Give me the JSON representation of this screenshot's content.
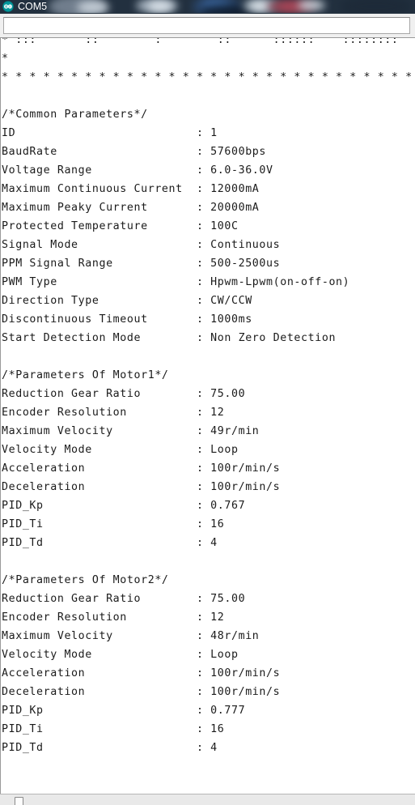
{
  "window": {
    "title": "COM5",
    "app_icon": "arduino-logo-icon",
    "titlebar_bg": "#22303f",
    "title_color": "#ffffff",
    "accent": "#00979c"
  },
  "toolbar": {
    "send_input_value": "",
    "send_input_placeholder": ""
  },
  "console": {
    "text_color": "#1b1b1b",
    "background": "#ffffff",
    "content": "* :::       ::        :        ::      ::::::    ::::::::       ::\n*\n* * * * * * * * * * * * * * * * * * * * * * * * * * * * * * * * *\n\n/*Common Parameters*/\nID                          : 1\nBaudRate                    : 57600bps\nVoltage Range               : 6.0-36.0V\nMaximum Continuous Current  : 12000mA\nMaximum Peaky Current       : 20000mA\nProtected Temperature       : 100C\nSignal Mode                 : Continuous\nPPM Signal Range            : 500-2500us\nPWM Type                    : Hpwm-Lpwm(on-off-on)\nDirection Type              : CW/CCW\nDiscontinuous Timeout       : 1000ms\nStart Detection Mode        : Non Zero Detection\n\n/*Parameters Of Motor1*/\nReduction Gear Ratio        : 75.00\nEncoder Resolution          : 12\nMaximum Velocity            : 49r/min\nVelocity Mode               : Loop\nAcceleration                : 100r/min/s\nDeceleration                : 100r/min/s\nPID_Kp                      : 0.767\nPID_Ti                      : 16\nPID_Td                      : 4\n\n/*Parameters Of Motor2*/\nReduction Gear Ratio        : 75.00\nEncoder Resolution          : 12\nMaximum Velocity            : 48r/min\nVelocity Mode               : Loop\nAcceleration                : 100r/min/s\nDeceleration                : 100r/min/s\nPID_Kp                      : 0.777\nPID_Ti                      : 16\nPID_Td                      : 4\n",
    "sections": [
      {
        "heading": "/*Common Parameters*/",
        "rows": [
          {
            "label": "ID",
            "value": "1"
          },
          {
            "label": "BaudRate",
            "value": "57600bps"
          },
          {
            "label": "Voltage Range",
            "value": "6.0-36.0V"
          },
          {
            "label": "Maximum Continuous Current",
            "value": "12000mA"
          },
          {
            "label": "Maximum Peaky Current",
            "value": "20000mA"
          },
          {
            "label": "Protected Temperature",
            "value": "100C"
          },
          {
            "label": "Signal Mode",
            "value": "Continuous"
          },
          {
            "label": "PPM Signal Range",
            "value": "500-2500us"
          },
          {
            "label": "PWM Type",
            "value": "Hpwm-Lpwm(on-off-on)"
          },
          {
            "label": "Direction Type",
            "value": "CW/CCW"
          },
          {
            "label": "Discontinuous Timeout",
            "value": "1000ms"
          },
          {
            "label": "Start Detection Mode",
            "value": "Non Zero Detection"
          }
        ]
      },
      {
        "heading": "/*Parameters Of Motor1*/",
        "rows": [
          {
            "label": "Reduction Gear Ratio",
            "value": "75.00"
          },
          {
            "label": "Encoder Resolution",
            "value": "12"
          },
          {
            "label": "Maximum Velocity",
            "value": "49r/min"
          },
          {
            "label": "Velocity Mode",
            "value": "Loop"
          },
          {
            "label": "Acceleration",
            "value": "100r/min/s"
          },
          {
            "label": "Deceleration",
            "value": "100r/min/s"
          },
          {
            "label": "PID_Kp",
            "value": "0.767"
          },
          {
            "label": "PID_Ti",
            "value": "16"
          },
          {
            "label": "PID_Td",
            "value": "4"
          }
        ]
      },
      {
        "heading": "/*Parameters Of Motor2*/",
        "rows": [
          {
            "label": "Reduction Gear Ratio",
            "value": "75.00"
          },
          {
            "label": "Encoder Resolution",
            "value": "12"
          },
          {
            "label": "Maximum Velocity",
            "value": "48r/min"
          },
          {
            "label": "Velocity Mode",
            "value": "Loop"
          },
          {
            "label": "Acceleration",
            "value": "100r/min/s"
          },
          {
            "label": "Deceleration",
            "value": "100r/min/s"
          },
          {
            "label": "PID_Kp",
            "value": "0.777"
          },
          {
            "label": "PID_Ti",
            "value": "16"
          },
          {
            "label": "PID_Td",
            "value": "4"
          }
        ]
      }
    ]
  },
  "statusbar": {
    "autoscroll_checked": false
  }
}
